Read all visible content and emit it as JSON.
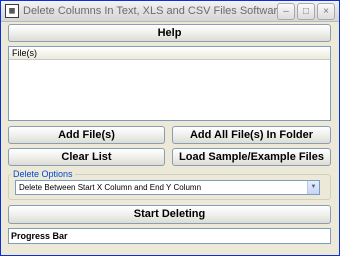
{
  "window": {
    "title": "Delete Columns In Text, XLS and CSV Files Software",
    "icon": "app-icon",
    "controls": {
      "minimize": "‒",
      "maximize": "□",
      "close": "×"
    }
  },
  "buttons": {
    "help": "Help",
    "add_files": "Add File(s)",
    "add_all_folder": "Add All File(s) In Folder",
    "clear_list": "Clear List",
    "load_sample": "Load Sample/Example Files",
    "start_deleting": "Start Deleting"
  },
  "file_list": {
    "header": "File(s)",
    "items": []
  },
  "delete_options": {
    "group_label": "Delete Options",
    "selected": "Delete Between Start X Column and End Y Column"
  },
  "progress": {
    "label": "Progress Bar",
    "value": 0
  }
}
